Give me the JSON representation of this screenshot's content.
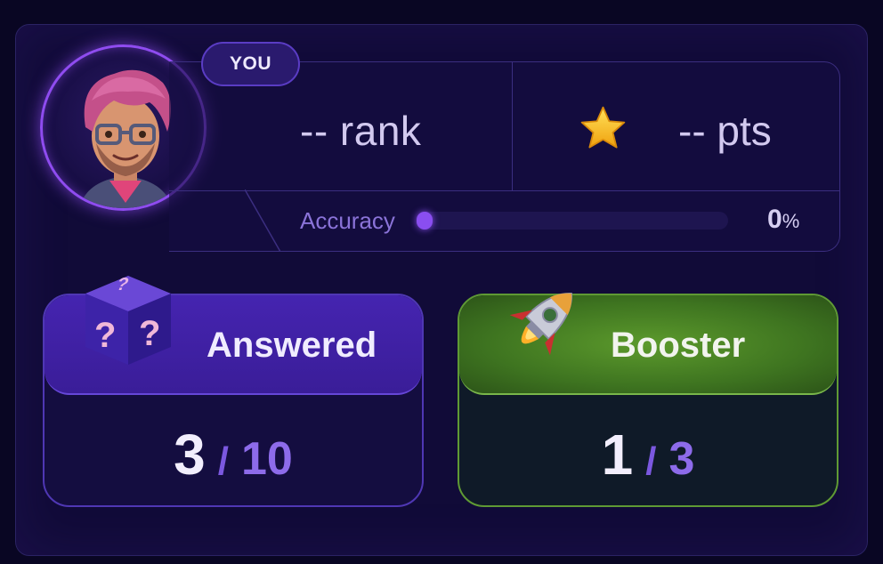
{
  "profile": {
    "badge": "YOU",
    "rank": "-- rank",
    "points": "-- pts"
  },
  "accuracy": {
    "label": "Accuracy",
    "value": "0",
    "unit": "%",
    "fraction": 0.0
  },
  "cards": {
    "answered": {
      "title": "Answered",
      "current": "3",
      "separator": "/",
      "total": "10"
    },
    "booster": {
      "title": "Booster",
      "current": "1",
      "separator": "/",
      "total": "3"
    }
  },
  "icons": {
    "avatar": "avatar-icon",
    "star": "star-icon",
    "mystery_box": "mystery-box-icon",
    "rocket": "rocket-icon"
  },
  "colors": {
    "accent": "#8f4cf0",
    "answered_header": "#4524b0",
    "booster_header": "#5c9a2c"
  }
}
